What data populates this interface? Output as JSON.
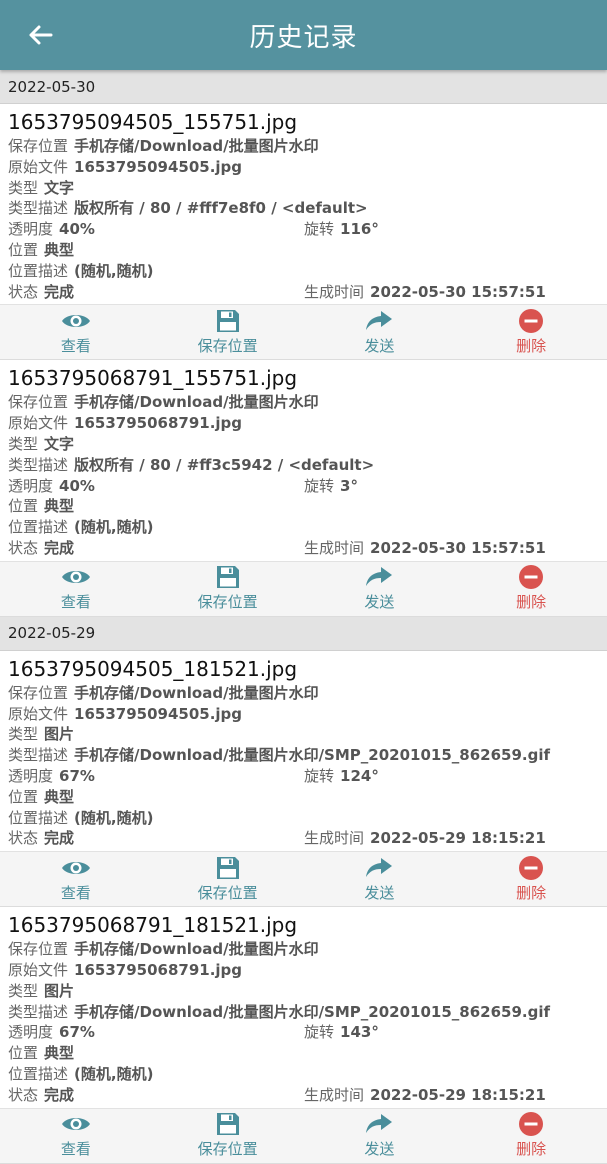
{
  "header": {
    "title": "历史记录"
  },
  "labels": {
    "save_location": "保存位置",
    "original_file": "原始文件",
    "type": "类型",
    "type_desc": "类型描述",
    "opacity": "透明度",
    "rotation": "旋转",
    "position": "位置",
    "position_desc": "位置描述",
    "status": "状态",
    "generated_time": "生成时间"
  },
  "actions": {
    "view": "查看",
    "save_location": "保存位置",
    "send": "发送",
    "delete": "删除"
  },
  "groups": [
    {
      "date": "2022-05-30",
      "records": [
        {
          "filename": "1653795094505_155751.jpg",
          "save_location": "手机存储/Download/批量图片水印",
          "original_file": "1653795094505.jpg",
          "type": "文字",
          "type_desc": "版权所有 / 80 / #fff7e8f0 / <default>",
          "opacity": "40%",
          "rotation": "116°",
          "position": "典型",
          "position_desc": "(随机,随机)",
          "status": "完成",
          "generated_time": "2022-05-30 15:57:51"
        },
        {
          "filename": "1653795068791_155751.jpg",
          "save_location": "手机存储/Download/批量图片水印",
          "original_file": "1653795068791.jpg",
          "type": "文字",
          "type_desc": "版权所有 / 80 / #ff3c5942 / <default>",
          "opacity": "40%",
          "rotation": "3°",
          "position": "典型",
          "position_desc": "(随机,随机)",
          "status": "完成",
          "generated_time": "2022-05-30 15:57:51"
        }
      ]
    },
    {
      "date": "2022-05-29",
      "records": [
        {
          "filename": "1653795094505_181521.jpg",
          "save_location": "手机存储/Download/批量图片水印",
          "original_file": "1653795094505.jpg",
          "type": "图片",
          "type_desc": "手机存储/Download/批量图片水印/SMP_20201015_862659.gif",
          "opacity": "67%",
          "rotation": "124°",
          "position": "典型",
          "position_desc": "(随机,随机)",
          "status": "完成",
          "generated_time": "2022-05-29 18:15:21"
        },
        {
          "filename": "1653795068791_181521.jpg",
          "save_location": "手机存储/Download/批量图片水印",
          "original_file": "1653795068791.jpg",
          "type": "图片",
          "type_desc": "手机存储/Download/批量图片水印/SMP_20201015_862659.gif",
          "opacity": "67%",
          "rotation": "143°",
          "position": "典型",
          "position_desc": "(随机,随机)",
          "status": "完成",
          "generated_time": "2022-05-29 18:15:21"
        }
      ]
    }
  ],
  "colors": {
    "appbar": "#55929f",
    "accent": "#4a8e9b",
    "delete": "#d9534f"
  }
}
